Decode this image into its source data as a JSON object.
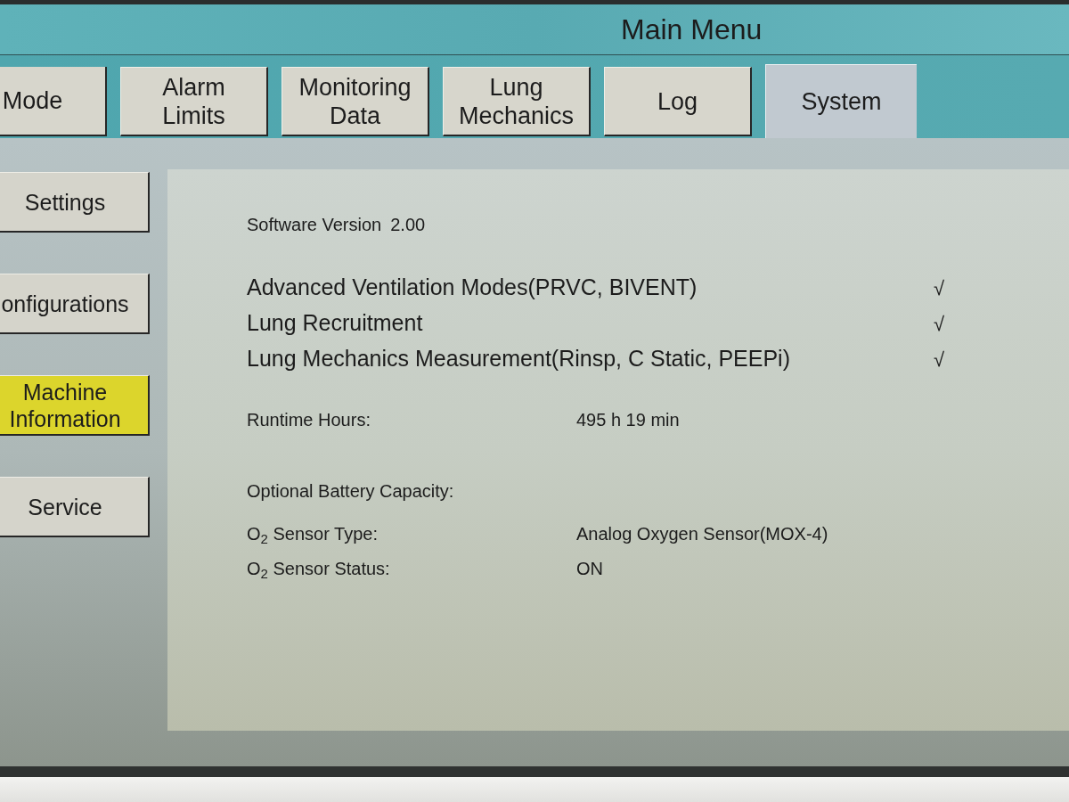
{
  "title": "Main Menu",
  "tabs": [
    {
      "label": "Mode",
      "selected": false
    },
    {
      "label": "Alarm Limits",
      "selected": false
    },
    {
      "label": "Monitoring Data",
      "selected": false
    },
    {
      "label": "Lung Mechanics",
      "selected": false
    },
    {
      "label": "Log",
      "selected": false
    },
    {
      "label": "System",
      "selected": true
    }
  ],
  "sidebar": {
    "items": [
      {
        "label": "Settings",
        "selected": false
      },
      {
        "label": "onfigurations",
        "selected": false
      },
      {
        "label": "Machine Information",
        "selected": true
      },
      {
        "label": "Service",
        "selected": false
      }
    ]
  },
  "info": {
    "software_version": {
      "label": "Software Version",
      "value": "2.00"
    },
    "options": [
      {
        "label": "Advanced Ventilation Modes(PRVC, BIVENT)",
        "mark": "√"
      },
      {
        "label": "Lung Recruitment",
        "mark": "√"
      },
      {
        "label": "Lung Mechanics Measurement(Rinsp, C Static, PEEPi)",
        "mark": "√"
      }
    ],
    "fields": [
      {
        "label": "Runtime Hours:",
        "value": "495 h 19 min"
      },
      {
        "label": "Optional Battery Capacity:"
      },
      {
        "label": "O$_{2}$ Sensor Type:",
        "value": "Analog Oxygen Sensor(MOX-4)"
      },
      {
        "label": "O$_{2}$ Sensor Status:",
        "value": "ON"
      }
    ]
  }
}
